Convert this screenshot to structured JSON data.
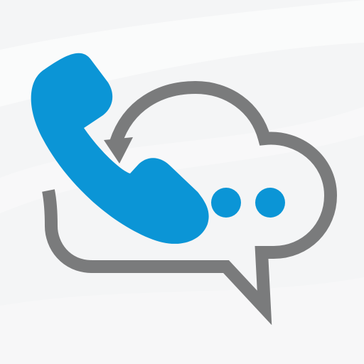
{
  "icon": {
    "name": "cloud-call-chat-icon",
    "parts": {
      "background": "background-sheen",
      "cloud": "cloud-chat-bubble-icon",
      "arrow": "refresh-arrow-icon",
      "phone": "phone-handset-icon",
      "dots": "typing-dots-icon"
    }
  },
  "colors": {
    "background": "#f4f5f6",
    "sheen": "#ffffff",
    "cloud_outline": "#7a7b7c",
    "phone": "#0b95d6",
    "dots": "#0b95d6"
  }
}
